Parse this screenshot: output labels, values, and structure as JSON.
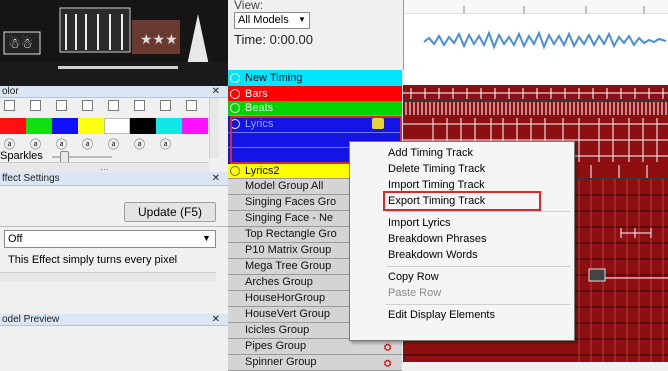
{
  "left": {
    "color_panel": {
      "title": "olor",
      "sparkles_label": "Sparkles"
    },
    "effect_settings": {
      "title": "ffect Settings",
      "update_button": "Update (F5)",
      "effect_value": "Off",
      "description": "This Effect simply turns every pixel"
    },
    "model_preview": {
      "title": "odel Preview"
    }
  },
  "view": {
    "label": "View:",
    "select_value": "All Models",
    "time": "Time: 0:00.00"
  },
  "timing_rows": [
    {
      "label": "New Timing",
      "color": "#00e5ff"
    },
    {
      "label": "Bars",
      "color": "#ff0000"
    },
    {
      "label": "Beats",
      "color": "#00d400"
    },
    {
      "label": "Lyrics",
      "color": "#1414e6"
    },
    {
      "label": "Lyrics2",
      "color": "#ffff00"
    }
  ],
  "model_rows": [
    "Model Group All",
    "Singing Faces Gro",
    "Singing Face - Ne",
    "Top Rectangle Gro",
    "P10 Matrix Group",
    "Mega Tree Group",
    "Arches Group",
    "HouseHorGroup",
    "HouseVert Group",
    "Icicles Group",
    "Pipes Group",
    "Spinner Group"
  ],
  "context_menu": {
    "items": [
      "Add Timing Track",
      "Delete Timing Track",
      "Import Timing Track",
      "Export Timing Track",
      "Import Lyrics",
      "Breakdown Phrases",
      "Breakdown Words",
      "Copy Row",
      "Paste Row",
      "Edit Display Elements"
    ]
  },
  "colors": {
    "highlight": "#d62b2b",
    "group_row": "#d4d4d4",
    "timeline_red": "#8e0f12"
  }
}
